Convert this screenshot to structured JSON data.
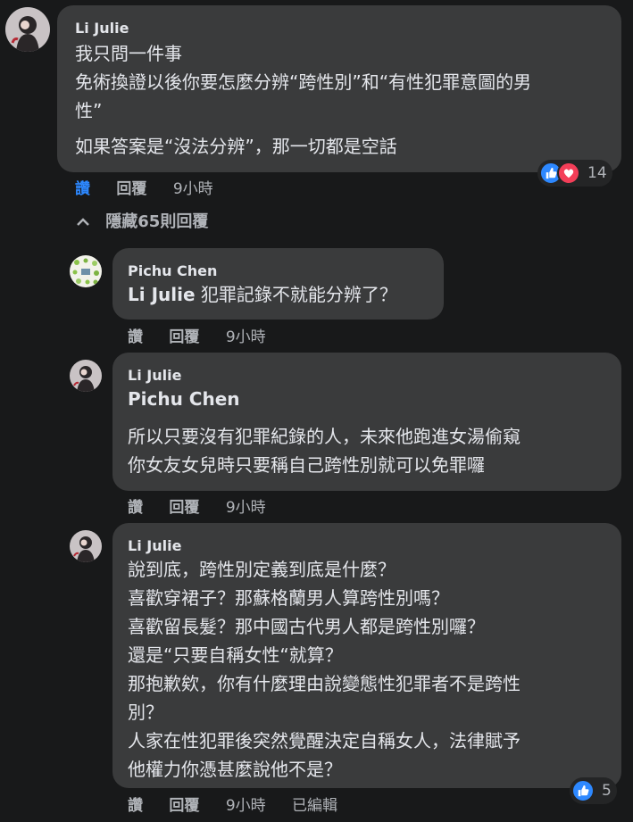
{
  "comments": [
    {
      "author": "Li Julie",
      "lines": [
        "我只問一件事",
        "免術換證以後你要怎麼分辨“跨性別”和“有性犯罪意圖的男",
        "性”",
        "如果答案是“沒法分辨”，那一切都是空話"
      ],
      "actions": {
        "like": "讚",
        "reply": "回覆",
        "time": "9小時"
      },
      "reactions": {
        "count": "14"
      }
    },
    {
      "author": "Pichu Chen",
      "mention": "Li Julie",
      "text": "犯罪記錄不就能分辨了？",
      "actions": {
        "like": "讚",
        "reply": "回覆",
        "time": "9小時"
      }
    },
    {
      "author": "Li Julie",
      "mention": "Pichu Chen",
      "lines": [
        "所以只要沒有犯罪紀錄的人，未來他跑進女湯偷窺",
        "你女友女兒時只要稱自己跨性別就可以免罪囉"
      ],
      "actions": {
        "like": "讚",
        "reply": "回覆",
        "time": "9小時"
      }
    },
    {
      "author": "Li Julie",
      "lines": [
        "說到底，跨性別定義到底是什麼？",
        "喜歡穿裙子？那蘇格蘭男人算跨性別嗎？",
        "喜歡留長髮？那中國古代男人都是跨性別囉？",
        "還是“只要自稱女性“就算？",
        "那抱歉欸，你有什麼理由說變態性犯罪者不是跨性",
        "別？",
        "人家在性犯罪後突然覺醒決定自稱女人，法律賦予",
        "他權力你憑甚麼說他不是？"
      ],
      "actions": {
        "like": "讚",
        "reply": "回覆",
        "time": "9小時",
        "edited": "已編輯"
      },
      "reactions": {
        "count": "5"
      }
    }
  ],
  "toggle": {
    "label": "隱藏65則回覆"
  },
  "colors": {
    "background": "#18191a",
    "bubble": "#3a3b3c",
    "text": "#e4e6eb",
    "muted": "#b0b3b8",
    "like_blue": "#2d88ff",
    "love_red": "#f33e58"
  }
}
